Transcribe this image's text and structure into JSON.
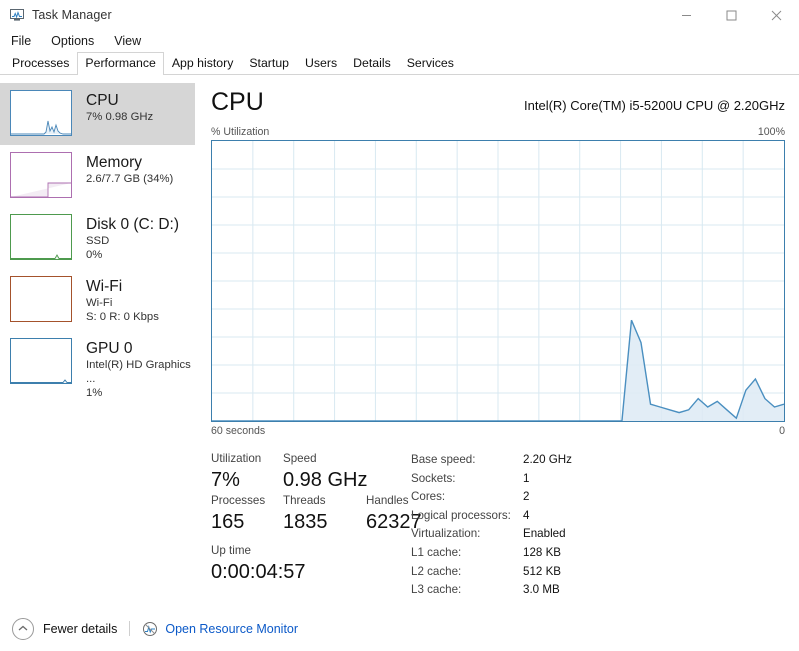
{
  "window": {
    "title": "Task Manager",
    "icon": "task-manager-icon",
    "controls": {
      "minimize": "minimize-icon",
      "maximize": "maximize-icon",
      "close": "close-icon"
    }
  },
  "menu": {
    "items": [
      {
        "label": "File"
      },
      {
        "label": "Options"
      },
      {
        "label": "View"
      }
    ]
  },
  "tabs": [
    {
      "label": "Processes",
      "active": false
    },
    {
      "label": "Performance",
      "active": true
    },
    {
      "label": "App history",
      "active": false
    },
    {
      "label": "Startup",
      "active": false
    },
    {
      "label": "Users",
      "active": false
    },
    {
      "label": "Details",
      "active": false
    },
    {
      "label": "Services",
      "active": false
    }
  ],
  "sidebar": {
    "items": [
      {
        "name": "cpu",
        "title": "CPU",
        "sub1": "7%  0.98 GHz",
        "sub2": "",
        "color": "#4a87b8",
        "selected": true
      },
      {
        "name": "memory",
        "title": "Memory",
        "sub1": "2.6/7.7 GB (34%)",
        "sub2": "",
        "color": "#ad6fb0",
        "selected": false
      },
      {
        "name": "disk-0",
        "title": "Disk 0 (C: D:)",
        "sub1": "SSD",
        "sub2": "0%",
        "color": "#4e9a4e",
        "selected": false
      },
      {
        "name": "wifi",
        "title": "Wi-Fi",
        "sub1": "Wi-Fi",
        "sub2": "S: 0 R: 0 Kbps",
        "color": "#a4522c",
        "selected": false
      },
      {
        "name": "gpu-0",
        "title": "GPU 0",
        "sub1": "Intel(R) HD Graphics ...",
        "sub2": "1%",
        "color": "#3d7fad",
        "selected": false
      }
    ]
  },
  "main": {
    "title": "CPU",
    "model": "Intel(R) Core(TM) i5-5200U CPU @ 2.20GHz",
    "graph_top_label": "% Utilization",
    "graph_top_right": "100%",
    "graph_bottom_left": "60 seconds",
    "graph_bottom_right": "0",
    "stats": {
      "utilization_label": "Utilization",
      "utilization_value": "7%",
      "speed_label": "Speed",
      "speed_value": "0.98 GHz",
      "processes_label": "Processes",
      "processes_value": "165",
      "threads_label": "Threads",
      "threads_value": "1835",
      "handles_label": "Handles",
      "handles_value": "62327",
      "uptime_label": "Up time",
      "uptime_value": "0:00:04:57"
    },
    "specs": [
      {
        "key": "Base speed:",
        "value": "2.20 GHz"
      },
      {
        "key": "Sockets:",
        "value": "1"
      },
      {
        "key": "Cores:",
        "value": "2"
      },
      {
        "key": "Logical processors:",
        "value": "4"
      },
      {
        "key": "Virtualization:",
        "value": "Enabled"
      },
      {
        "key": "L1 cache:",
        "value": "128 KB"
      },
      {
        "key": "L2 cache:",
        "value": "512 KB"
      },
      {
        "key": "L3 cache:",
        "value": "3.0 MB"
      }
    ]
  },
  "footer": {
    "fewer_details": "Fewer details",
    "open_resource_monitor": "Open Resource Monitor",
    "link_color": "#0b59c8"
  },
  "chart_data": {
    "type": "area",
    "title": "% Utilization",
    "xlabel": "60 seconds",
    "ylabel": "% Utilization",
    "ylim": [
      0,
      100
    ],
    "xlim": [
      60,
      0
    ],
    "grid": true,
    "grid_rows": 10,
    "grid_cols": 14,
    "line_color": "#4a8fc0",
    "fill_color": "#ddeaf5",
    "x": [
      60,
      59,
      58,
      57,
      56,
      55,
      54,
      53,
      52,
      51,
      50,
      49,
      48,
      47,
      46,
      45,
      44,
      43,
      42,
      41,
      40,
      39,
      38,
      37,
      36,
      35,
      34,
      33,
      32,
      31,
      30,
      29,
      28,
      27,
      26,
      25,
      24,
      23,
      22,
      21,
      20,
      19,
      18,
      17,
      16,
      15,
      14,
      13,
      12,
      11,
      10,
      9,
      8,
      7,
      6,
      5,
      4,
      3,
      2,
      1,
      0
    ],
    "values": [
      0,
      0,
      0,
      0,
      0,
      0,
      0,
      0,
      0,
      0,
      0,
      0,
      0,
      0,
      0,
      0,
      0,
      0,
      0,
      0,
      0,
      0,
      0,
      0,
      0,
      0,
      0,
      0,
      0,
      0,
      0,
      0,
      0,
      0,
      0,
      0,
      0,
      0,
      0,
      0,
      0,
      0,
      0,
      0,
      36,
      28,
      6,
      5,
      4,
      3,
      4,
      8,
      5,
      7,
      4,
      1,
      11,
      15,
      8,
      5,
      6
    ]
  }
}
